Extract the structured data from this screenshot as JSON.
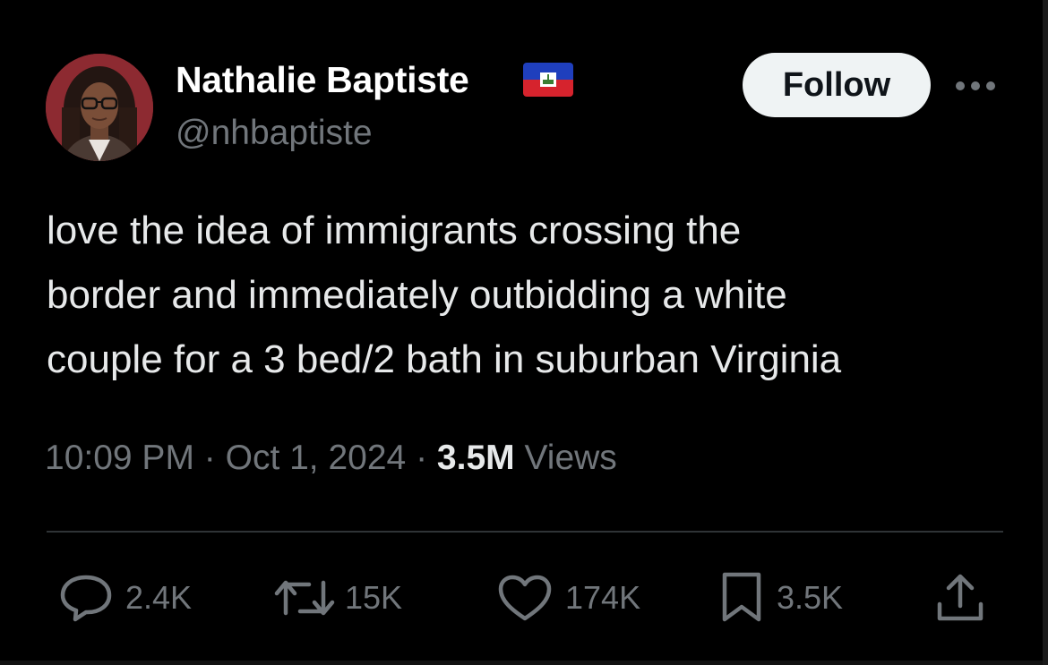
{
  "author": {
    "display_name": "Nathalie Baptiste",
    "handle": "@nhbaptiste",
    "flag_icon": "haiti-flag-icon"
  },
  "header": {
    "follow_label": "Follow",
    "more_icon": "more-options-icon"
  },
  "tweet": {
    "text_lines": [
      "love the idea of immigrants crossing the",
      "border and immediately outbidding a white",
      "couple for a 3 bed/2 bath in suburban Virginia"
    ]
  },
  "meta": {
    "time": "10:09 PM",
    "separator": "·",
    "date": "Oct 1, 2024",
    "views_count": "3.5M",
    "views_label": "Views"
  },
  "actions": {
    "replies": "2.4K",
    "reposts": "15K",
    "likes": "174K",
    "bookmarks": "3.5K"
  },
  "colors": {
    "background": "#000000",
    "primary_text": "#e7e9ea",
    "secondary_text": "#71767b",
    "follow_button_bg": "#eff3f4",
    "divider": "#2f3336"
  }
}
